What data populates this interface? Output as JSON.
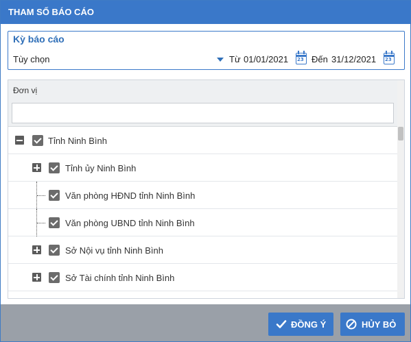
{
  "dialog": {
    "title": "THAM SỐ BÁO CÁO"
  },
  "period": {
    "title": "Kỳ báo cáo",
    "option": "Tùy chọn",
    "from_label": "Từ",
    "from_date": "01/01/2021",
    "to_label": "Đến",
    "to_date": "31/12/2021"
  },
  "units": {
    "header": "Đơn vị",
    "search_value": "",
    "tree": [
      {
        "label": "Tỉnh Ninh Bình",
        "level": 0,
        "expander": "minus",
        "checked": true
      },
      {
        "label": "Tỉnh ủy Ninh Bình",
        "level": 1,
        "expander": "plus",
        "checked": true
      },
      {
        "label": "Văn phòng HĐND tỉnh Ninh Bình",
        "level": 1,
        "expander": "none",
        "checked": true
      },
      {
        "label": "Văn phòng UBND tỉnh Ninh Bình",
        "level": 1,
        "expander": "none",
        "checked": true
      },
      {
        "label": "Sở Nội vụ tỉnh Ninh Bình",
        "level": 1,
        "expander": "plus",
        "checked": true
      },
      {
        "label": "Sở Tài chính tỉnh Ninh Bình",
        "level": 1,
        "expander": "plus",
        "checked": true
      }
    ]
  },
  "footer": {
    "ok_label": "ĐỒNG Ý",
    "cancel_label": "HỦY BỎ"
  },
  "icons": {
    "dropdown": "caret-down-icon",
    "calendar": "calendar-icon",
    "expand": "plus-box-icon",
    "collapse": "minus-box-icon",
    "checkbox": "checkbox-checked-icon",
    "ok": "check-icon",
    "cancel": "ban-icon"
  },
  "colors": {
    "accent": "#3a78c9",
    "footer": "#9aa0a8",
    "checkbox": "#6b6b6b"
  }
}
